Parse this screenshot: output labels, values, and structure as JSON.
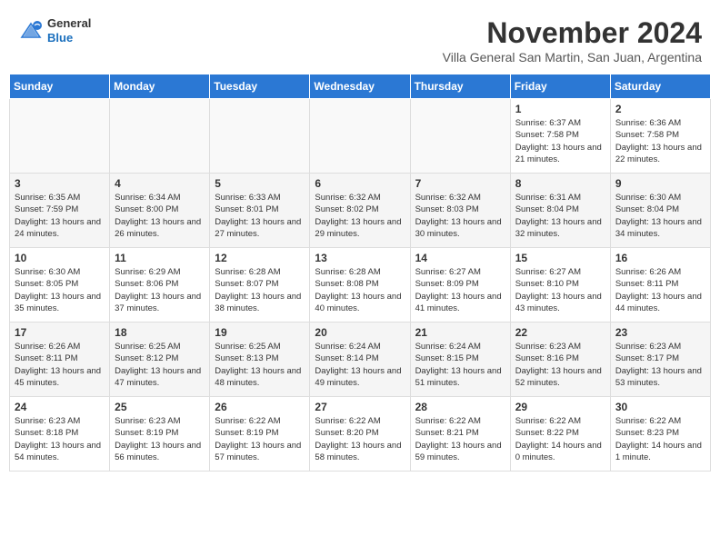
{
  "header": {
    "logo": {
      "general": "General",
      "blue": "Blue"
    },
    "title": "November 2024",
    "location": "Villa General San Martin, San Juan, Argentina"
  },
  "weekdays": [
    "Sunday",
    "Monday",
    "Tuesday",
    "Wednesday",
    "Thursday",
    "Friday",
    "Saturday"
  ],
  "weeks": [
    [
      {
        "day": "",
        "empty": true
      },
      {
        "day": "",
        "empty": true
      },
      {
        "day": "",
        "empty": true
      },
      {
        "day": "",
        "empty": true
      },
      {
        "day": "",
        "empty": true
      },
      {
        "day": "1",
        "sunrise": "Sunrise: 6:37 AM",
        "sunset": "Sunset: 7:58 PM",
        "daylight": "Daylight: 13 hours and 21 minutes."
      },
      {
        "day": "2",
        "sunrise": "Sunrise: 6:36 AM",
        "sunset": "Sunset: 7:58 PM",
        "daylight": "Daylight: 13 hours and 22 minutes."
      }
    ],
    [
      {
        "day": "3",
        "sunrise": "Sunrise: 6:35 AM",
        "sunset": "Sunset: 7:59 PM",
        "daylight": "Daylight: 13 hours and 24 minutes."
      },
      {
        "day": "4",
        "sunrise": "Sunrise: 6:34 AM",
        "sunset": "Sunset: 8:00 PM",
        "daylight": "Daylight: 13 hours and 26 minutes."
      },
      {
        "day": "5",
        "sunrise": "Sunrise: 6:33 AM",
        "sunset": "Sunset: 8:01 PM",
        "daylight": "Daylight: 13 hours and 27 minutes."
      },
      {
        "day": "6",
        "sunrise": "Sunrise: 6:32 AM",
        "sunset": "Sunset: 8:02 PM",
        "daylight": "Daylight: 13 hours and 29 minutes."
      },
      {
        "day": "7",
        "sunrise": "Sunrise: 6:32 AM",
        "sunset": "Sunset: 8:03 PM",
        "daylight": "Daylight: 13 hours and 30 minutes."
      },
      {
        "day": "8",
        "sunrise": "Sunrise: 6:31 AM",
        "sunset": "Sunset: 8:04 PM",
        "daylight": "Daylight: 13 hours and 32 minutes."
      },
      {
        "day": "9",
        "sunrise": "Sunrise: 6:30 AM",
        "sunset": "Sunset: 8:04 PM",
        "daylight": "Daylight: 13 hours and 34 minutes."
      }
    ],
    [
      {
        "day": "10",
        "sunrise": "Sunrise: 6:30 AM",
        "sunset": "Sunset: 8:05 PM",
        "daylight": "Daylight: 13 hours and 35 minutes."
      },
      {
        "day": "11",
        "sunrise": "Sunrise: 6:29 AM",
        "sunset": "Sunset: 8:06 PM",
        "daylight": "Daylight: 13 hours and 37 minutes."
      },
      {
        "day": "12",
        "sunrise": "Sunrise: 6:28 AM",
        "sunset": "Sunset: 8:07 PM",
        "daylight": "Daylight: 13 hours and 38 minutes."
      },
      {
        "day": "13",
        "sunrise": "Sunrise: 6:28 AM",
        "sunset": "Sunset: 8:08 PM",
        "daylight": "Daylight: 13 hours and 40 minutes."
      },
      {
        "day": "14",
        "sunrise": "Sunrise: 6:27 AM",
        "sunset": "Sunset: 8:09 PM",
        "daylight": "Daylight: 13 hours and 41 minutes."
      },
      {
        "day": "15",
        "sunrise": "Sunrise: 6:27 AM",
        "sunset": "Sunset: 8:10 PM",
        "daylight": "Daylight: 13 hours and 43 minutes."
      },
      {
        "day": "16",
        "sunrise": "Sunrise: 6:26 AM",
        "sunset": "Sunset: 8:11 PM",
        "daylight": "Daylight: 13 hours and 44 minutes."
      }
    ],
    [
      {
        "day": "17",
        "sunrise": "Sunrise: 6:26 AM",
        "sunset": "Sunset: 8:11 PM",
        "daylight": "Daylight: 13 hours and 45 minutes."
      },
      {
        "day": "18",
        "sunrise": "Sunrise: 6:25 AM",
        "sunset": "Sunset: 8:12 PM",
        "daylight": "Daylight: 13 hours and 47 minutes."
      },
      {
        "day": "19",
        "sunrise": "Sunrise: 6:25 AM",
        "sunset": "Sunset: 8:13 PM",
        "daylight": "Daylight: 13 hours and 48 minutes."
      },
      {
        "day": "20",
        "sunrise": "Sunrise: 6:24 AM",
        "sunset": "Sunset: 8:14 PM",
        "daylight": "Daylight: 13 hours and 49 minutes."
      },
      {
        "day": "21",
        "sunrise": "Sunrise: 6:24 AM",
        "sunset": "Sunset: 8:15 PM",
        "daylight": "Daylight: 13 hours and 51 minutes."
      },
      {
        "day": "22",
        "sunrise": "Sunrise: 6:23 AM",
        "sunset": "Sunset: 8:16 PM",
        "daylight": "Daylight: 13 hours and 52 minutes."
      },
      {
        "day": "23",
        "sunrise": "Sunrise: 6:23 AM",
        "sunset": "Sunset: 8:17 PM",
        "daylight": "Daylight: 13 hours and 53 minutes."
      }
    ],
    [
      {
        "day": "24",
        "sunrise": "Sunrise: 6:23 AM",
        "sunset": "Sunset: 8:18 PM",
        "daylight": "Daylight: 13 hours and 54 minutes."
      },
      {
        "day": "25",
        "sunrise": "Sunrise: 6:23 AM",
        "sunset": "Sunset: 8:19 PM",
        "daylight": "Daylight: 13 hours and 56 minutes."
      },
      {
        "day": "26",
        "sunrise": "Sunrise: 6:22 AM",
        "sunset": "Sunset: 8:19 PM",
        "daylight": "Daylight: 13 hours and 57 minutes."
      },
      {
        "day": "27",
        "sunrise": "Sunrise: 6:22 AM",
        "sunset": "Sunset: 8:20 PM",
        "daylight": "Daylight: 13 hours and 58 minutes."
      },
      {
        "day": "28",
        "sunrise": "Sunrise: 6:22 AM",
        "sunset": "Sunset: 8:21 PM",
        "daylight": "Daylight: 13 hours and 59 minutes."
      },
      {
        "day": "29",
        "sunrise": "Sunrise: 6:22 AM",
        "sunset": "Sunset: 8:22 PM",
        "daylight": "Daylight: 14 hours and 0 minutes."
      },
      {
        "day": "30",
        "sunrise": "Sunrise: 6:22 AM",
        "sunset": "Sunset: 8:23 PM",
        "daylight": "Daylight: 14 hours and 1 minute."
      }
    ]
  ]
}
